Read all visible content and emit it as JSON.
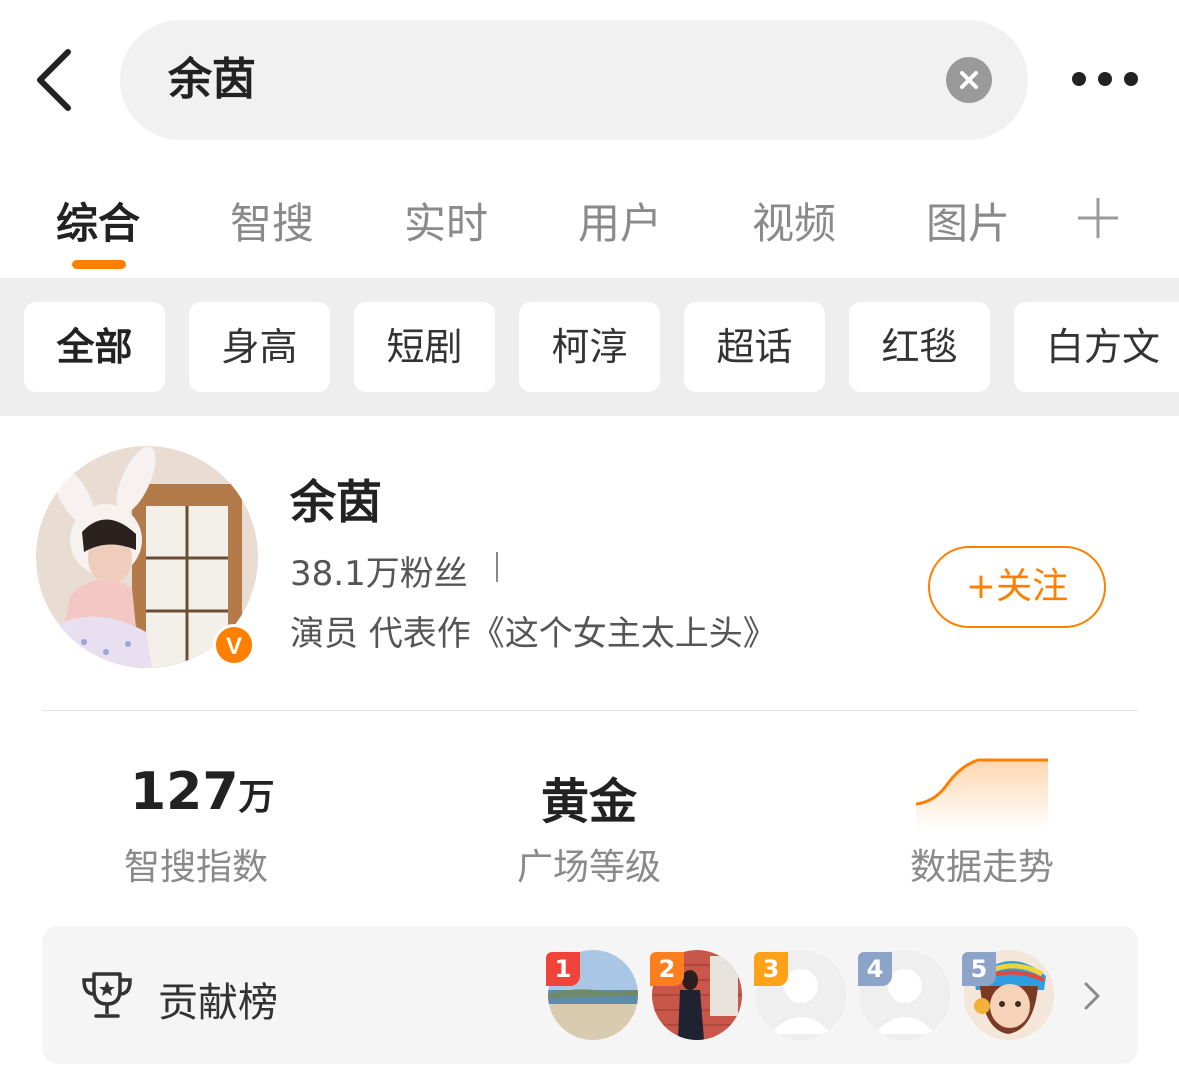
{
  "search": {
    "query": "余茵"
  },
  "tabs": [
    {
      "label": "综合",
      "active": true
    },
    {
      "label": "智搜",
      "active": false
    },
    {
      "label": "实时",
      "active": false
    },
    {
      "label": "用户",
      "active": false
    },
    {
      "label": "视频",
      "active": false
    },
    {
      "label": "图片",
      "active": false
    }
  ],
  "chips": [
    "全部",
    "身高",
    "短剧",
    "柯淳",
    "超话",
    "红毯",
    "白方文"
  ],
  "profile": {
    "name": "余茵",
    "fans": "38.1万粉丝",
    "description": "演员 代表作《这个女主太上头》",
    "follow_label": "+关注",
    "verified_badge": "V"
  },
  "stats": {
    "search_index": {
      "value": "127",
      "unit": "万",
      "label": "智搜指数"
    },
    "plaza_level": {
      "value": "黄金",
      "label": "广场等级"
    },
    "trend": {
      "label": "数据走势"
    }
  },
  "contribution": {
    "label": "贡献榜",
    "ranks": [
      {
        "rank": "1",
        "color": "#f0443a"
      },
      {
        "rank": "2",
        "color": "#ff7f1f"
      },
      {
        "rank": "3",
        "color": "#ffa21a"
      },
      {
        "rank": "4",
        "color": "#8da4c9"
      },
      {
        "rank": "5",
        "color": "#8da4c9"
      }
    ]
  },
  "colors": {
    "accent": "#ff7f00"
  },
  "icons": [
    "back-arrow-icon",
    "clear-icon",
    "more-icon",
    "plus-icon",
    "verified-icon",
    "trophy-icon",
    "chevron-right-icon"
  ]
}
